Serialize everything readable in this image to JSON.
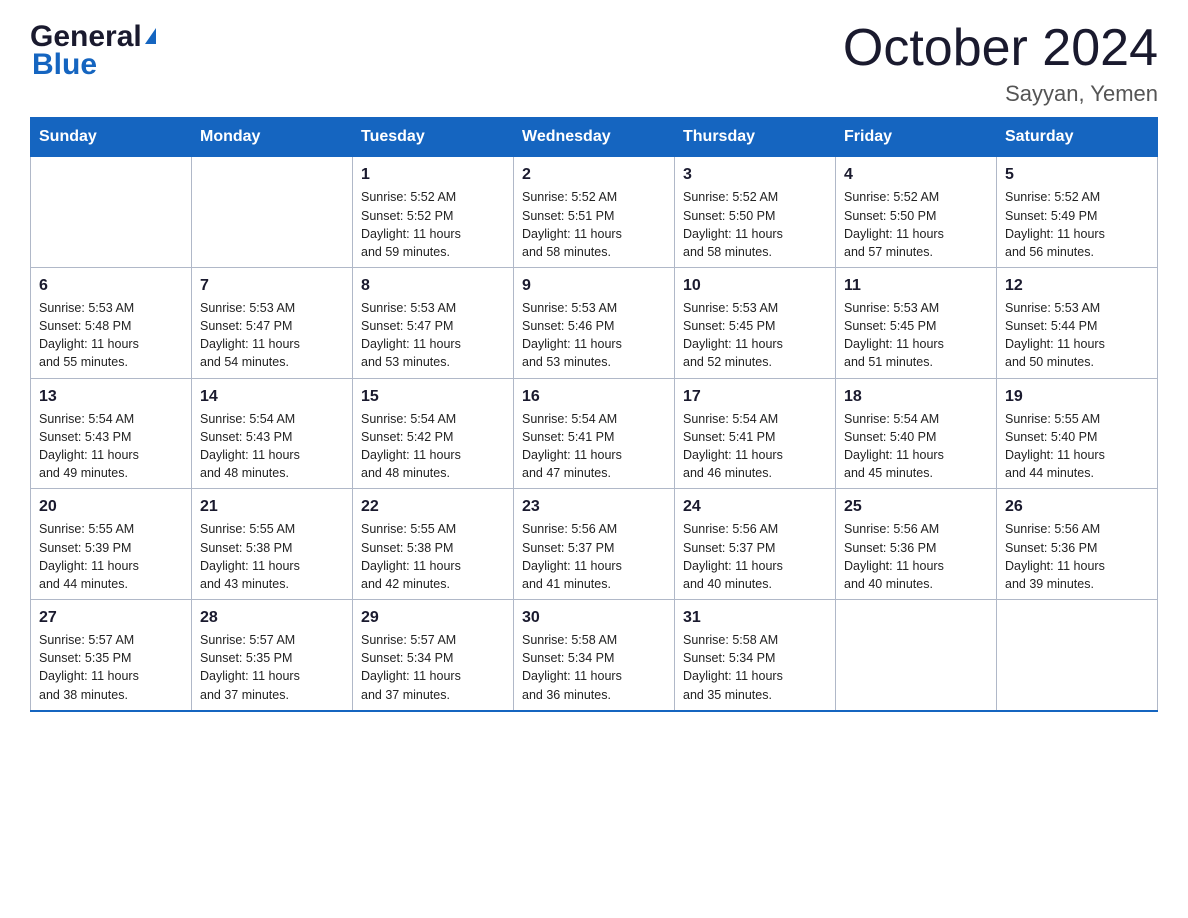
{
  "header": {
    "logo_general": "General",
    "logo_triangle": "▶",
    "logo_blue": "Blue",
    "month_title": "October 2024",
    "location": "Sayyan, Yemen"
  },
  "days_of_week": [
    "Sunday",
    "Monday",
    "Tuesday",
    "Wednesday",
    "Thursday",
    "Friday",
    "Saturday"
  ],
  "weeks": [
    [
      {
        "day": "",
        "info": ""
      },
      {
        "day": "",
        "info": ""
      },
      {
        "day": "1",
        "info": "Sunrise: 5:52 AM\nSunset: 5:52 PM\nDaylight: 11 hours\nand 59 minutes."
      },
      {
        "day": "2",
        "info": "Sunrise: 5:52 AM\nSunset: 5:51 PM\nDaylight: 11 hours\nand 58 minutes."
      },
      {
        "day": "3",
        "info": "Sunrise: 5:52 AM\nSunset: 5:50 PM\nDaylight: 11 hours\nand 58 minutes."
      },
      {
        "day": "4",
        "info": "Sunrise: 5:52 AM\nSunset: 5:50 PM\nDaylight: 11 hours\nand 57 minutes."
      },
      {
        "day": "5",
        "info": "Sunrise: 5:52 AM\nSunset: 5:49 PM\nDaylight: 11 hours\nand 56 minutes."
      }
    ],
    [
      {
        "day": "6",
        "info": "Sunrise: 5:53 AM\nSunset: 5:48 PM\nDaylight: 11 hours\nand 55 minutes."
      },
      {
        "day": "7",
        "info": "Sunrise: 5:53 AM\nSunset: 5:47 PM\nDaylight: 11 hours\nand 54 minutes."
      },
      {
        "day": "8",
        "info": "Sunrise: 5:53 AM\nSunset: 5:47 PM\nDaylight: 11 hours\nand 53 minutes."
      },
      {
        "day": "9",
        "info": "Sunrise: 5:53 AM\nSunset: 5:46 PM\nDaylight: 11 hours\nand 53 minutes."
      },
      {
        "day": "10",
        "info": "Sunrise: 5:53 AM\nSunset: 5:45 PM\nDaylight: 11 hours\nand 52 minutes."
      },
      {
        "day": "11",
        "info": "Sunrise: 5:53 AM\nSunset: 5:45 PM\nDaylight: 11 hours\nand 51 minutes."
      },
      {
        "day": "12",
        "info": "Sunrise: 5:53 AM\nSunset: 5:44 PM\nDaylight: 11 hours\nand 50 minutes."
      }
    ],
    [
      {
        "day": "13",
        "info": "Sunrise: 5:54 AM\nSunset: 5:43 PM\nDaylight: 11 hours\nand 49 minutes."
      },
      {
        "day": "14",
        "info": "Sunrise: 5:54 AM\nSunset: 5:43 PM\nDaylight: 11 hours\nand 48 minutes."
      },
      {
        "day": "15",
        "info": "Sunrise: 5:54 AM\nSunset: 5:42 PM\nDaylight: 11 hours\nand 48 minutes."
      },
      {
        "day": "16",
        "info": "Sunrise: 5:54 AM\nSunset: 5:41 PM\nDaylight: 11 hours\nand 47 minutes."
      },
      {
        "day": "17",
        "info": "Sunrise: 5:54 AM\nSunset: 5:41 PM\nDaylight: 11 hours\nand 46 minutes."
      },
      {
        "day": "18",
        "info": "Sunrise: 5:54 AM\nSunset: 5:40 PM\nDaylight: 11 hours\nand 45 minutes."
      },
      {
        "day": "19",
        "info": "Sunrise: 5:55 AM\nSunset: 5:40 PM\nDaylight: 11 hours\nand 44 minutes."
      }
    ],
    [
      {
        "day": "20",
        "info": "Sunrise: 5:55 AM\nSunset: 5:39 PM\nDaylight: 11 hours\nand 44 minutes."
      },
      {
        "day": "21",
        "info": "Sunrise: 5:55 AM\nSunset: 5:38 PM\nDaylight: 11 hours\nand 43 minutes."
      },
      {
        "day": "22",
        "info": "Sunrise: 5:55 AM\nSunset: 5:38 PM\nDaylight: 11 hours\nand 42 minutes."
      },
      {
        "day": "23",
        "info": "Sunrise: 5:56 AM\nSunset: 5:37 PM\nDaylight: 11 hours\nand 41 minutes."
      },
      {
        "day": "24",
        "info": "Sunrise: 5:56 AM\nSunset: 5:37 PM\nDaylight: 11 hours\nand 40 minutes."
      },
      {
        "day": "25",
        "info": "Sunrise: 5:56 AM\nSunset: 5:36 PM\nDaylight: 11 hours\nand 40 minutes."
      },
      {
        "day": "26",
        "info": "Sunrise: 5:56 AM\nSunset: 5:36 PM\nDaylight: 11 hours\nand 39 minutes."
      }
    ],
    [
      {
        "day": "27",
        "info": "Sunrise: 5:57 AM\nSunset: 5:35 PM\nDaylight: 11 hours\nand 38 minutes."
      },
      {
        "day": "28",
        "info": "Sunrise: 5:57 AM\nSunset: 5:35 PM\nDaylight: 11 hours\nand 37 minutes."
      },
      {
        "day": "29",
        "info": "Sunrise: 5:57 AM\nSunset: 5:34 PM\nDaylight: 11 hours\nand 37 minutes."
      },
      {
        "day": "30",
        "info": "Sunrise: 5:58 AM\nSunset: 5:34 PM\nDaylight: 11 hours\nand 36 minutes."
      },
      {
        "day": "31",
        "info": "Sunrise: 5:58 AM\nSunset: 5:34 PM\nDaylight: 11 hours\nand 35 minutes."
      },
      {
        "day": "",
        "info": ""
      },
      {
        "day": "",
        "info": ""
      }
    ]
  ]
}
